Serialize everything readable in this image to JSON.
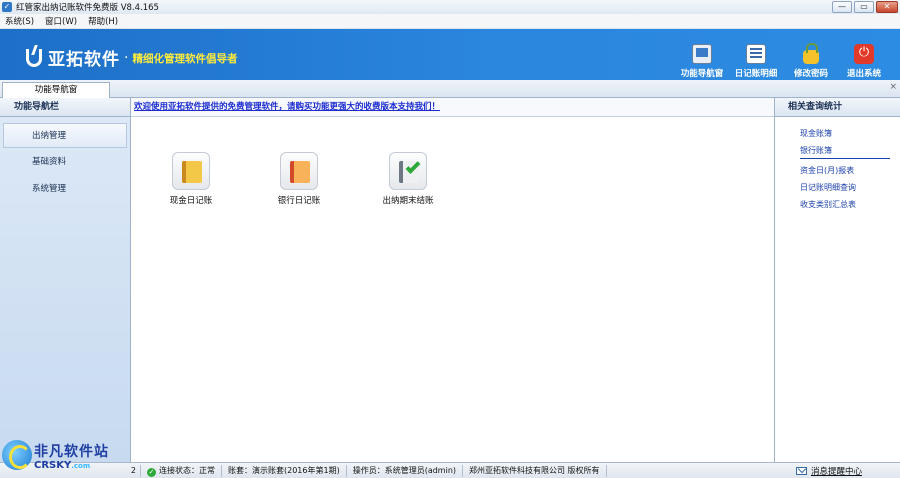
{
  "window": {
    "title": "红管家出纳记账软件免费版 V8.4.165",
    "minimize": "—",
    "restore": "▭",
    "close": "✕"
  },
  "menu": [
    "系统(S)",
    "窗口(W)",
    "帮助(H)"
  ],
  "banner": {
    "brand": "亚拓软件",
    "dot": "·",
    "slogan": "精细化管理软件倡导者",
    "toolbar": [
      {
        "label": "功能导航窗",
        "icon": "monitor-icon"
      },
      {
        "label": "日记账明细",
        "icon": "ledger-list-icon"
      },
      {
        "label": "修改密码",
        "icon": "lock-icon"
      },
      {
        "label": "退出系统",
        "icon": "power-icon"
      }
    ]
  },
  "tabs": {
    "active": "功能导航窗",
    "close": "×"
  },
  "left_nav": {
    "header": "功能导航栏",
    "items": [
      "出纳管理",
      "基础资料",
      "系统管理"
    ]
  },
  "main": {
    "notice": "欢迎使用亚拓软件提供的免费管理软件，请购买功能更强大的收费版本支持我们！",
    "functions": [
      {
        "label": "现金日记账",
        "icon": "cash-journal-icon"
      },
      {
        "label": "银行日记账",
        "icon": "bank-journal-icon"
      },
      {
        "label": "出纳期末结账",
        "icon": "period-close-icon"
      }
    ]
  },
  "right_panel": {
    "header": "相关查询统计",
    "links": [
      "现金账簿",
      "银行账簿",
      "资金日(月)报表",
      "日记账明细查询",
      "收支类别汇总表"
    ]
  },
  "status": {
    "left_num": "2",
    "connection": "连接状态：正常",
    "account": "账套：演示账套(2016年第1期)",
    "operator": "操作员：系统管理员(admin)",
    "company": "郑州亚拓软件科技有限公司  版权所有",
    "message_center": "消息提醒中心"
  },
  "watermark": {
    "cn": "非凡软件站",
    "en": "CRSKY",
    "en_suffix": ".com"
  }
}
